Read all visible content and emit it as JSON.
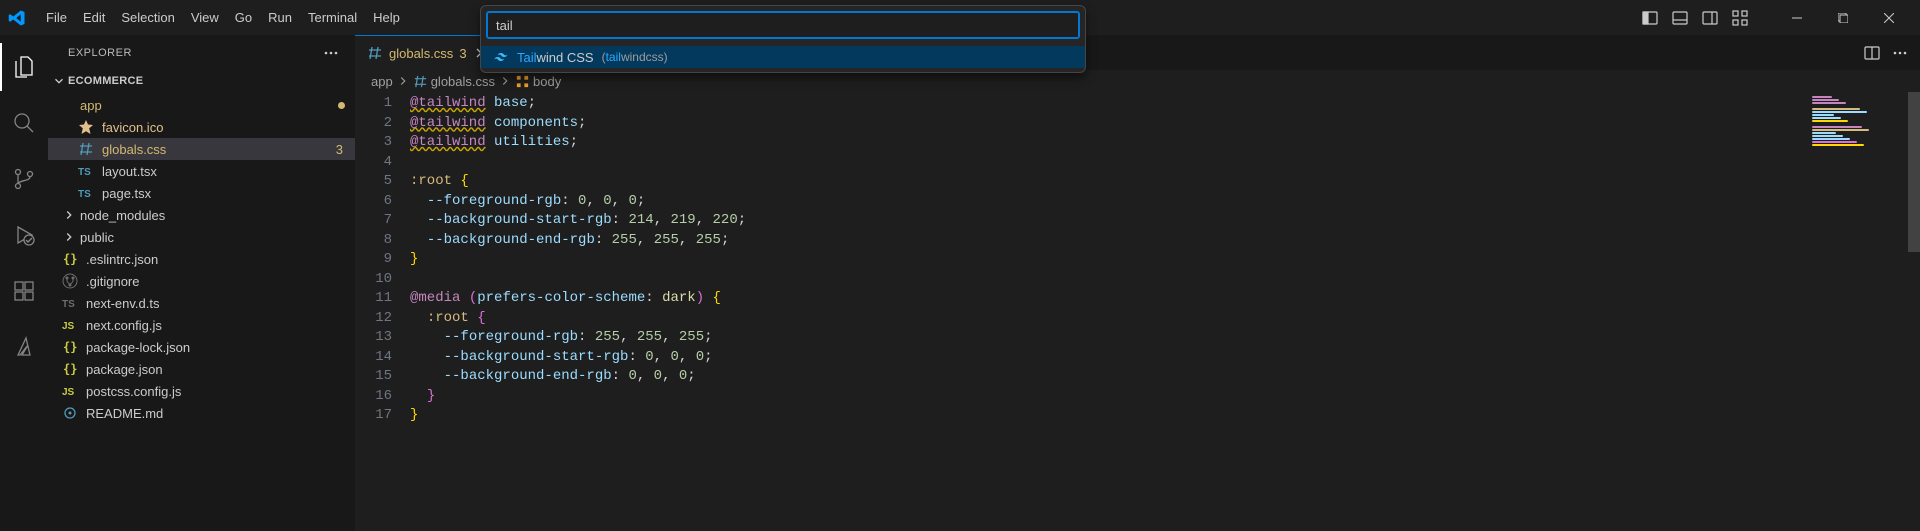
{
  "menubar": [
    "File",
    "Edit",
    "Selection",
    "View",
    "Go",
    "Run",
    "Terminal",
    "Help"
  ],
  "explorer": {
    "title": "EXPLORER",
    "project": "ECOMMERCE",
    "tree": {
      "app": {
        "label": "app",
        "modified": true,
        "items": [
          {
            "name": "favicon.ico",
            "icon": "star",
            "color": "#e2c08d"
          },
          {
            "name": "globals.css",
            "icon": "hash",
            "color": "#d4b970",
            "selected": true,
            "badge": "3"
          },
          {
            "name": "layout.tsx",
            "icon": "ts",
            "color": "#cccccc"
          },
          {
            "name": "page.tsx",
            "icon": "ts",
            "color": "#cccccc"
          }
        ]
      },
      "folders": [
        {
          "name": "node_modules",
          "muted": true
        },
        {
          "name": "public"
        }
      ],
      "rootFiles": [
        {
          "name": ".eslintrc.json",
          "icon": "json"
        },
        {
          "name": ".gitignore",
          "icon": "git"
        },
        {
          "name": "next-env.d.ts",
          "icon": "tsd"
        },
        {
          "name": "next.config.js",
          "icon": "js"
        },
        {
          "name": "package-lock.json",
          "icon": "json"
        },
        {
          "name": "package.json",
          "icon": "json"
        },
        {
          "name": "postcss.config.js",
          "icon": "js"
        },
        {
          "name": "README.md",
          "icon": "md"
        }
      ]
    }
  },
  "tab": {
    "label": "globals.css",
    "badge": "3"
  },
  "breadcrumb": {
    "folder": "app",
    "file": "globals.css",
    "symbol": "body"
  },
  "quickInput": {
    "value": "tail",
    "suggestion": {
      "matchedPart": "Tail",
      "restLabel": "wind CSS",
      "detailPrefix": "(",
      "detailMatch": "tail",
      "detailRest": "windcss)"
    }
  },
  "code": [
    {
      "n": 1,
      "html": "<span class='tk-at'>@tailwind</span><span class='tk-punct'> </span><span class='tk-word'>base</span><span class='tk-punct'>;</span>"
    },
    {
      "n": 2,
      "html": "<span class='tk-at'>@tailwind</span><span class='tk-punct'> </span><span class='tk-word'>components</span><span class='tk-punct'>;</span>"
    },
    {
      "n": 3,
      "html": "<span class='tk-at'>@tailwind</span><span class='tk-punct'> </span><span class='tk-word'>utilities</span><span class='tk-punct'>;</span>"
    },
    {
      "n": 4,
      "html": ""
    },
    {
      "n": 5,
      "html": "<span class='tk-selector'>:root</span><span class='tk-punct'> </span><span class='tk-brace'>{</span>"
    },
    {
      "n": 6,
      "html": "<span class='tk-punct'>  </span><span class='tk-prop'>--foreground-rgb</span><span class='tk-punct'>: </span><span class='tk-num'>0</span><span class='tk-punct'>, </span><span class='tk-num'>0</span><span class='tk-punct'>, </span><span class='tk-num'>0</span><span class='tk-punct'>;</span>"
    },
    {
      "n": 7,
      "html": "<span class='tk-punct'>  </span><span class='tk-prop'>--background-start-rgb</span><span class='tk-punct'>: </span><span class='tk-num'>214</span><span class='tk-punct'>, </span><span class='tk-num'>219</span><span class='tk-punct'>, </span><span class='tk-num'>220</span><span class='tk-punct'>;</span>"
    },
    {
      "n": 8,
      "html": "<span class='tk-punct'>  </span><span class='tk-prop'>--background-end-rgb</span><span class='tk-punct'>: </span><span class='tk-num'>255</span><span class='tk-punct'>, </span><span class='tk-num'>255</span><span class='tk-punct'>, </span><span class='tk-num'>255</span><span class='tk-punct'>;</span>"
    },
    {
      "n": 9,
      "html": "<span class='tk-brace'>}</span>"
    },
    {
      "n": 10,
      "html": ""
    },
    {
      "n": 11,
      "html": "<span class='tk-at' style='text-decoration:none;color:#c586c0'>@media</span><span class='tk-punct'> </span><span class='tk-paren'>(</span><span class='tk-prop'>prefers-color-scheme</span><span class='tk-punct'>: </span><span class='tk-func'>dark</span><span class='tk-paren'>)</span><span class='tk-punct'> </span><span class='tk-brace'>{</span>"
    },
    {
      "n": 12,
      "html": "<span class='tk-punct'>  </span><span class='tk-selector'>:root</span><span class='tk-punct'> </span><span class='tk-brace2'>{</span>"
    },
    {
      "n": 13,
      "html": "<span class='tk-punct'>    </span><span class='tk-prop'>--foreground-rgb</span><span class='tk-punct'>: </span><span class='tk-num'>255</span><span class='tk-punct'>, </span><span class='tk-num'>255</span><span class='tk-punct'>, </span><span class='tk-num'>255</span><span class='tk-punct'>;</span>"
    },
    {
      "n": 14,
      "html": "<span class='tk-punct'>    </span><span class='tk-prop'>--background-start-rgb</span><span class='tk-punct'>: </span><span class='tk-num'>0</span><span class='tk-punct'>, </span><span class='tk-num'>0</span><span class='tk-punct'>, </span><span class='tk-num'>0</span><span class='tk-punct'>;</span>"
    },
    {
      "n": 15,
      "html": "<span class='tk-punct'>    </span><span class='tk-prop'>--background-end-rgb</span><span class='tk-punct'>: </span><span class='tk-num'>0</span><span class='tk-punct'>, </span><span class='tk-num'>0</span><span class='tk-punct'>, </span><span class='tk-num'>0</span><span class='tk-punct'>;</span>"
    },
    {
      "n": 16,
      "html": "<span class='tk-punct'>  </span><span class='tk-brace2'>}</span>"
    },
    {
      "n": 17,
      "html": "<span class='tk-brace'>}</span>"
    }
  ]
}
